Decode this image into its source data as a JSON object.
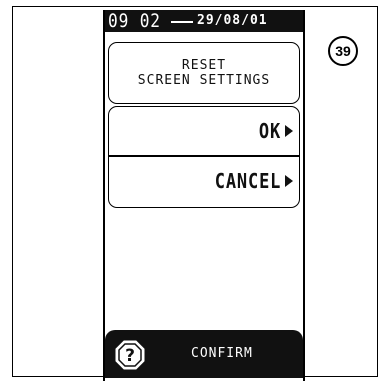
{
  "status_bar": {
    "time": "09 02",
    "date": "29/08/01"
  },
  "title": {
    "line1": "RESET",
    "line2": "SCREEN SETTINGS"
  },
  "actions": {
    "ok_label": "OK",
    "cancel_label": "CANCEL"
  },
  "bottom_bar": {
    "help_icon": "question-mark-icon",
    "confirm_label": "CONFIRM"
  },
  "step_badge": "39"
}
